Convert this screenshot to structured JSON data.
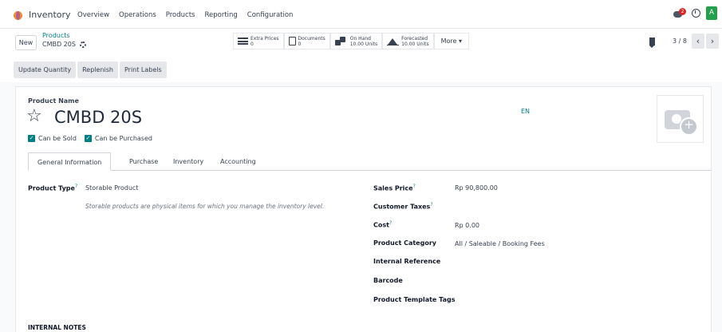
{
  "navbar": {
    "app_name": "Inventory",
    "menu": [
      "Overview",
      "Operations",
      "Products",
      "Reporting",
      "Configuration"
    ],
    "message_count": "2",
    "avatar_letter": "A"
  },
  "control_panel": {
    "new_label": "New",
    "breadcrumb_parent": "Products",
    "breadcrumb_current": "CMBD 20S",
    "smart_buttons": {
      "extra_prices": {
        "label": "Extra Prices",
        "value": "0"
      },
      "documents": {
        "label": "Documents",
        "value": "0"
      },
      "on_hand": {
        "label": "On Hand",
        "value": "10.00 Units"
      },
      "forecasted": {
        "label": "Forecasted",
        "value": "10.00 Units"
      },
      "more": "More ▾"
    },
    "pager": {
      "value": "3 / 8",
      "prev": "‹",
      "next": "›"
    }
  },
  "actions": [
    "Update Quantity",
    "Replenish",
    "Print Labels"
  ],
  "form": {
    "product_name_label": "Product Name",
    "product_name": "CMBD 20S",
    "lang": "EN",
    "can_be_sold": "Can be Sold",
    "can_be_purchased": "Can be Purchased",
    "tabs": [
      "General Information",
      "Purchase",
      "Inventory",
      "Accounting"
    ],
    "product_type_label": "Product Type",
    "product_type_value": "Storable Product",
    "product_type_note": "Storable products are physical items for which you manage the inventory level.",
    "sales_price_label": "Sales Price",
    "sales_price_value": "Rp 90,800.00",
    "customer_taxes_label": "Customer Taxes",
    "cost_label": "Cost",
    "cost_value": "Rp 0.00",
    "product_category_label": "Product Category",
    "product_category_value": "All / Saleable / Booking Fees",
    "internal_reference_label": "Internal Reference",
    "barcode_label": "Barcode",
    "template_tags_label": "Product Template Tags",
    "internal_notes_label": "INTERNAL NOTES"
  },
  "colors": {
    "accent": "#017e84",
    "badge": "#dc2626",
    "avatar": "#22a04b"
  }
}
